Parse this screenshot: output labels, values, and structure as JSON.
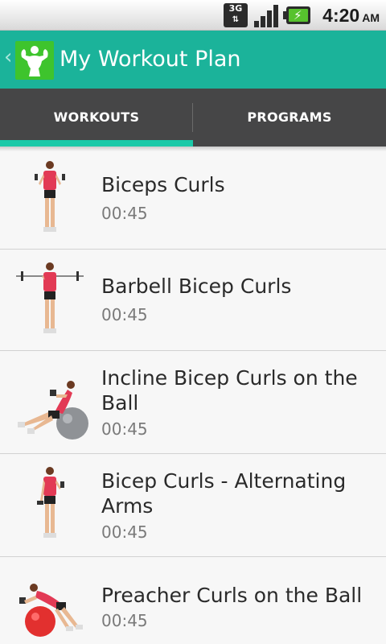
{
  "status_bar": {
    "network": "3G",
    "time": "4:20",
    "ampm": "AM",
    "icons": [
      "3g-data-icon",
      "signal-strength-icon",
      "battery-charging-icon"
    ]
  },
  "action_bar": {
    "title": "My Workout Plan",
    "icon": "bodybuilder-icon",
    "background_color": "#1bb39a"
  },
  "tabs": [
    {
      "label": "WORKOUTS",
      "selected": true
    },
    {
      "label": "PROGRAMS",
      "selected": false
    }
  ],
  "colors": {
    "accent": "#1bc9a8",
    "tab_bar": "#464647",
    "list_background": "#f7f7f7"
  },
  "workouts": [
    {
      "title": "Biceps Curls",
      "duration": "00:45",
      "thumbnail": "dumbbell-biceps-curl-figure"
    },
    {
      "title": "Barbell Bicep Curls",
      "duration": "00:45",
      "thumbnail": "barbell-curl-figure"
    },
    {
      "title": "Incline Bicep Curls on the Ball",
      "duration": "00:45",
      "thumbnail": "incline-ball-curl-figure"
    },
    {
      "title": "Bicep Curls - Alternating Arms",
      "duration": "00:45",
      "thumbnail": "alternating-curl-figure"
    },
    {
      "title": "Preacher Curls on the Ball",
      "duration": "00:45",
      "thumbnail": "preacher-ball-curl-figure"
    }
  ]
}
